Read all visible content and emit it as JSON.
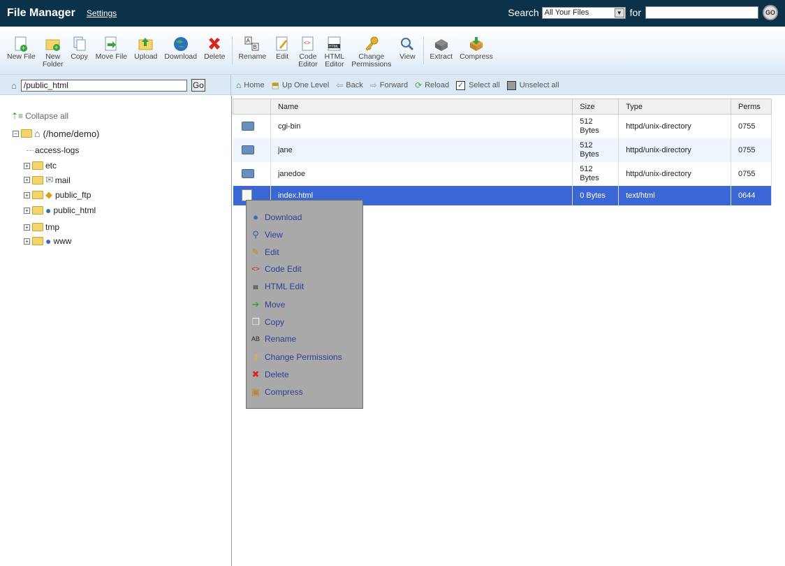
{
  "header": {
    "title": "File Manager",
    "settings": "Settings",
    "search_label": "Search",
    "search_scope": "All Your Files",
    "for_label": "for",
    "go": "GO"
  },
  "toolbar": [
    {
      "label": "New File",
      "icon": "new-file-icon"
    },
    {
      "label": "New\nFolder",
      "icon": "new-folder-icon"
    },
    {
      "label": "Copy",
      "icon": "copy-icon"
    },
    {
      "label": "Move File",
      "icon": "move-file-icon"
    },
    {
      "label": "Upload",
      "icon": "upload-icon"
    },
    {
      "label": "Download",
      "icon": "download-icon"
    },
    {
      "label": "Delete",
      "icon": "delete-icon"
    },
    {
      "label": "Rename",
      "icon": "rename-icon"
    },
    {
      "label": "Edit",
      "icon": "edit-icon"
    },
    {
      "label": "Code\nEditor",
      "icon": "code-editor-icon"
    },
    {
      "label": "HTML\nEditor",
      "icon": "html-editor-icon"
    },
    {
      "label": "Change\nPermissions",
      "icon": "permissions-icon"
    },
    {
      "label": "View",
      "icon": "view-icon"
    },
    {
      "label": "Extract",
      "icon": "extract-icon"
    },
    {
      "label": "Compress",
      "icon": "compress-icon"
    }
  ],
  "nav": {
    "path": "/public_html",
    "go": "Go",
    "home": "Home",
    "up": "Up One Level",
    "back": "Back",
    "forward": "Forward",
    "reload": "Reload",
    "select_all": "Select all",
    "unselect_all": "Unselect all"
  },
  "tree": {
    "collapse_all": "Collapse all",
    "root": "(/home/demo)",
    "items": [
      "access-logs",
      "etc",
      "mail",
      "public_ftp",
      "public_html",
      "tmp",
      "www"
    ]
  },
  "table": {
    "headers": {
      "name": "Name",
      "size": "Size",
      "type": "Type",
      "perms": "Perms"
    },
    "rows": [
      {
        "name": "cgi-bin",
        "size": "512\nBytes",
        "type": "httpd/unix-directory",
        "perms": "0755"
      },
      {
        "name": "jane",
        "size": "512\nBytes",
        "type": "httpd/unix-directory",
        "perms": "0755"
      },
      {
        "name": "janedoe",
        "size": "512\nBytes",
        "type": "httpd/unix-directory",
        "perms": "0755"
      },
      {
        "name": "index.html",
        "size": "0 Bytes",
        "type": "text/html",
        "perms": "0644"
      }
    ]
  },
  "context_menu": [
    {
      "label": "Download",
      "icon": "download-icon"
    },
    {
      "label": "View",
      "icon": "view-icon"
    },
    {
      "label": "Edit",
      "icon": "edit-icon"
    },
    {
      "label": "Code Edit",
      "icon": "code-edit-icon"
    },
    {
      "label": "HTML Edit",
      "icon": "html-edit-icon"
    },
    {
      "label": "Move",
      "icon": "move-icon"
    },
    {
      "label": "Copy",
      "icon": "copy-icon"
    },
    {
      "label": "Rename",
      "icon": "rename-icon"
    },
    {
      "label": "Change Permissions",
      "icon": "permissions-icon"
    },
    {
      "label": "Delete",
      "icon": "delete-icon"
    },
    {
      "label": "Compress",
      "icon": "compress-icon"
    }
  ]
}
